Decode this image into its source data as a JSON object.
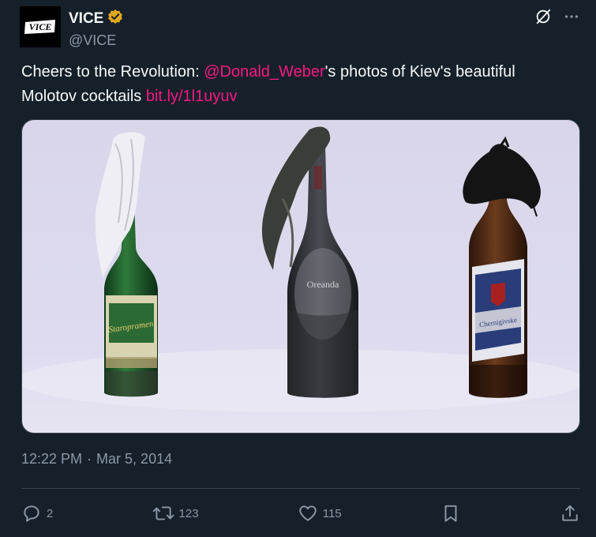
{
  "author": {
    "display_name": "VICE",
    "handle": "@VICE",
    "avatar_logo_text": "VICE",
    "verified_badge_color": "#e0a81e"
  },
  "tweet": {
    "text_prefix": "Cheers to the Revolution: ",
    "mention": "@Donald_Weber",
    "text_middle": "'s photos of Kiev's beautiful Molotov cocktails ",
    "link": "bit.ly/1l1uyuv",
    "time": "12:22 PM",
    "separator": "·",
    "date": "Mar 5, 2014",
    "link_color": "#f91880"
  },
  "media": {
    "bottle_labels": [
      "Staropramen",
      "Oreanda",
      "Chernigivske"
    ]
  },
  "metrics": {
    "replies": "2",
    "retweets": "123",
    "likes": "115"
  },
  "icons": {
    "grok": "grok-icon",
    "more": "more-icon",
    "reply": "reply-icon",
    "retweet": "retweet-icon",
    "like": "like-icon",
    "bookmark": "bookmark-icon",
    "share": "share-icon"
  }
}
